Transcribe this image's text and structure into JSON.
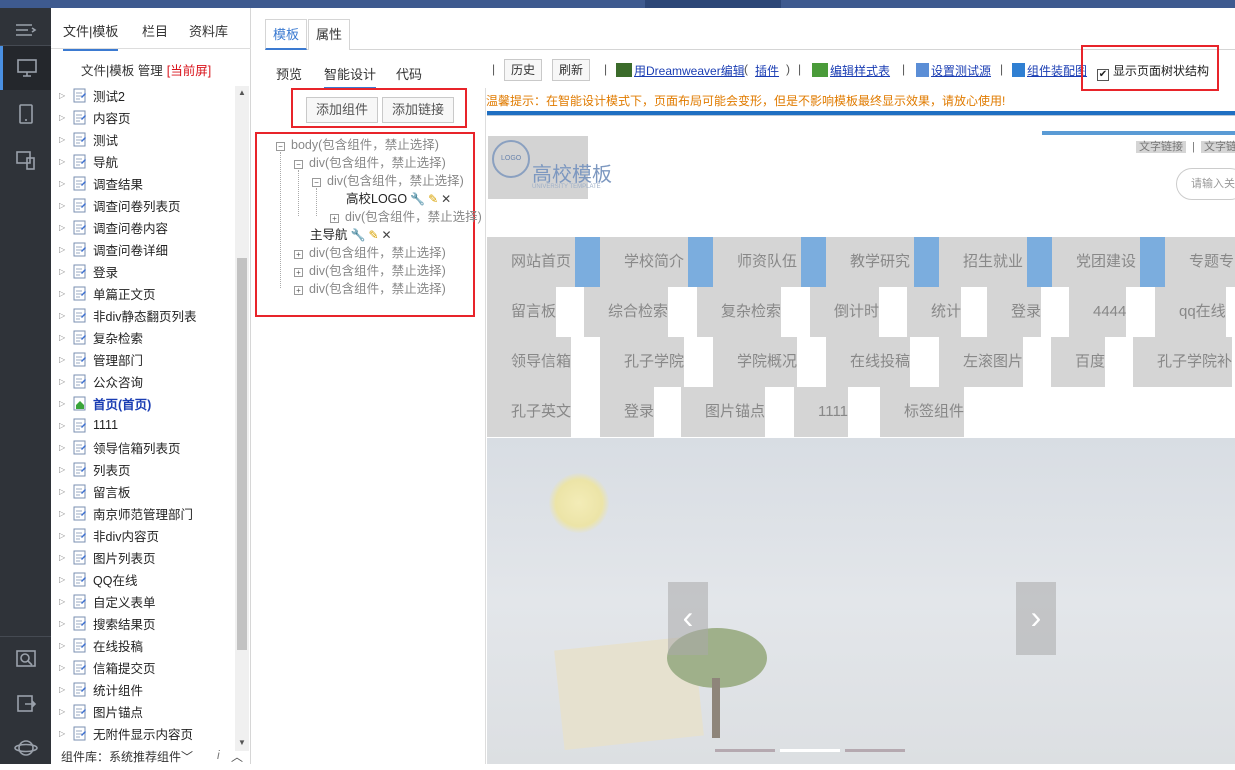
{
  "file_panel": {
    "tabs": [
      "文件|模板",
      "栏目",
      "资料库"
    ],
    "header_prefix": "文件|模板 管理",
    "header_current": "[当前屏]",
    "items": [
      {
        "label": "测试2"
      },
      {
        "label": "内容页"
      },
      {
        "label": "测试"
      },
      {
        "label": "导航"
      },
      {
        "label": "调查结果"
      },
      {
        "label": "调查问卷列表页"
      },
      {
        "label": "调查问卷内容"
      },
      {
        "label": "调查问卷详细"
      },
      {
        "label": "登录"
      },
      {
        "label": "单篇正文页"
      },
      {
        "label": "非div静态翻页列表"
      },
      {
        "label": "复杂检索"
      },
      {
        "label": "管理部门"
      },
      {
        "label": "公众咨询"
      },
      {
        "label": "首页",
        "suffix": "(首页)",
        "home": true
      },
      {
        "label": "1111"
      },
      {
        "label": "领导信箱列表页"
      },
      {
        "label": "列表页"
      },
      {
        "label": "留言板"
      },
      {
        "label": "南京师范管理部门"
      },
      {
        "label": "非div内容页"
      },
      {
        "label": "图片列表页"
      },
      {
        "label": "QQ在线"
      },
      {
        "label": "自定义表单"
      },
      {
        "label": "搜索结果页"
      },
      {
        "label": "在线投稿"
      },
      {
        "label": "信箱提交页"
      },
      {
        "label": "统计组件"
      },
      {
        "label": "图片锚点"
      },
      {
        "label": "无附件显示内容页"
      }
    ],
    "bottom_label": "组件库：系统推荐组件"
  },
  "main": {
    "tabs": [
      "模板",
      "属性"
    ],
    "subtabs": [
      "预览",
      "智能设计",
      "代码"
    ],
    "toolbar": {
      "history": "历史",
      "refresh": "刷新",
      "dw_edit": "用Dreamweaver编辑",
      "plugin": "插件",
      "edit_style": "编辑样式表",
      "set_test_source": "设置测试源",
      "component_map": "组件装配图",
      "show_tree": "显示页面树状结构"
    },
    "add_component": "添加组件",
    "add_link": "添加链接",
    "tree": {
      "body": "body(包含组件，禁止选择)",
      "div": "div(包含组件，禁止选择)",
      "logo": "高校LOGO",
      "main_nav": "主导航"
    }
  },
  "preview": {
    "tip": "温馨提示：在智能设计模式下，页面布局可能会变形，但是不影响模板最终显示效果，请放心使用!",
    "top_links": [
      "文字链接",
      "文字链"
    ],
    "logo_seal_text": "LOGO",
    "logo_name": "高校模板",
    "logo_en": "UNIVERSITY TEMPLATE",
    "search_placeholder": "请输入关",
    "nav_rows": [
      [
        "网站首页",
        "学校简介",
        "师资队伍",
        "教学研究",
        "招生就业",
        "党团建设",
        "专题专"
      ],
      [
        "留言板",
        "综合检索",
        "复杂检索",
        "倒计时",
        "统计",
        "登录",
        "4444",
        "qq在线"
      ],
      [
        "领导信箱",
        "孔子学院",
        "学院概况",
        "在线投稿",
        "左滚图片",
        "百度",
        "孔子学院补"
      ],
      [
        "孔子英文",
        "登录",
        "图片锚点",
        "1111",
        "标签组件"
      ]
    ]
  }
}
